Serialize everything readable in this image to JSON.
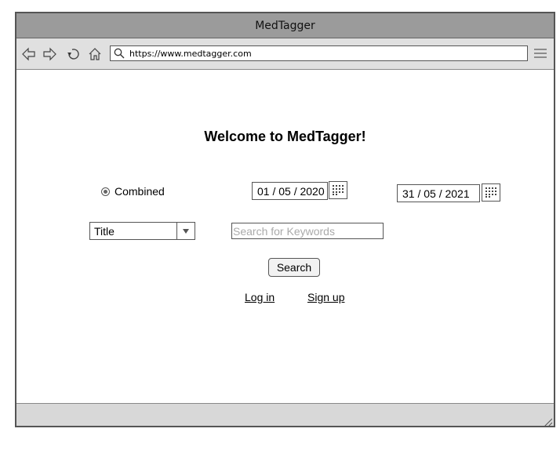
{
  "window": {
    "title": "MedTagger"
  },
  "toolbar": {
    "icons": [
      "back-icon",
      "forward-icon",
      "reload-icon",
      "home-icon",
      "search-icon",
      "menu-icon"
    ],
    "url": "https://www.medtagger.com"
  },
  "main": {
    "heading": "Welcome to MedTagger!",
    "radio": {
      "label": "Combined",
      "checked": true
    },
    "date_from": "01 / 05 / 2020",
    "date_to": "31 / 05 / 2021",
    "field_select": {
      "selected": "Title"
    },
    "keywords": {
      "value": "",
      "placeholder": "Search for Keywords"
    },
    "search_label": "Search",
    "login_label": "Log in",
    "signup_label": "Sign up"
  },
  "colors": {
    "titlebar": "#9b9b9b",
    "toolbar": "#e0e0e0",
    "statusbar": "#d8d8d8",
    "border": "#555555"
  }
}
